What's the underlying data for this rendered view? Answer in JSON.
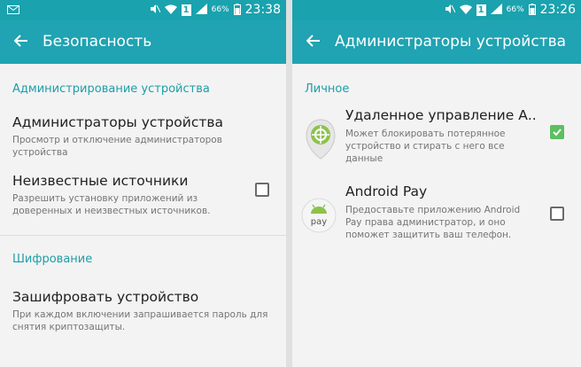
{
  "left": {
    "status": {
      "battery_text": "66%",
      "time": "23:38",
      "sim": "1"
    },
    "appbar": {
      "title": "Безопасность"
    },
    "sections": [
      {
        "header": "Администрирование устройства"
      },
      {
        "header": "Шифрование"
      }
    ],
    "items": [
      {
        "title": "Администраторы устройства",
        "subtitle": "Просмотр и отключение администраторов устройства"
      },
      {
        "title": "Неизвестные источники",
        "subtitle": "Разрешить установку приложений из доверенных и неизвестных источников.",
        "checked": false
      },
      {
        "title": "Зашифровать устройство",
        "subtitle": "При каждом включении запрашивается пароль для снятия криптозащиты."
      }
    ]
  },
  "right": {
    "status": {
      "battery_text": "66%",
      "time": "23:26",
      "sim": "1"
    },
    "appbar": {
      "title": "Администраторы устройства"
    },
    "section_header": "Личное",
    "items": [
      {
        "title": "Удаленное управление А..",
        "subtitle": "Может блокировать потерянное устройство и стирать с него все данные",
        "checked": true,
        "icon": "find-device-icon"
      },
      {
        "title": "Android Pay",
        "subtitle": "Предоставьте приложению Android Pay права администратор, и оно поможет защитить ваш телефон.",
        "checked": false,
        "icon": "android-pay-icon",
        "icon_text": "pay"
      }
    ]
  },
  "colors": {
    "appbar": "#20a3b2",
    "accent": "#1e9ea8",
    "checkbox_checked": "#5cbf61"
  }
}
